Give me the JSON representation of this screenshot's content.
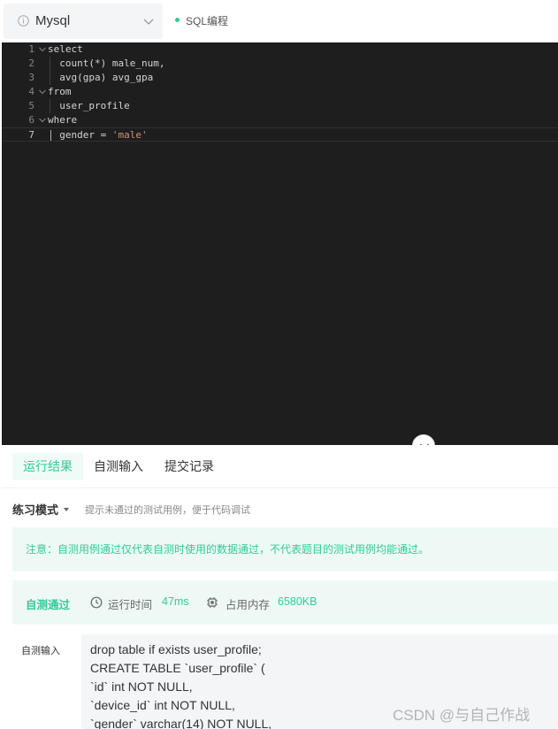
{
  "top": {
    "language": "Mysql",
    "mode_tag": "SQL编程"
  },
  "editor": {
    "lines": [
      {
        "n": "1",
        "code": "select"
      },
      {
        "n": "2",
        "code": "  count(*) male_num,"
      },
      {
        "n": "3",
        "code": "  avg(gpa) avg_gpa"
      },
      {
        "n": "4",
        "code": "from"
      },
      {
        "n": "5",
        "code": "  user_profile"
      },
      {
        "n": "6",
        "code": "where"
      },
      {
        "n": "7",
        "code": "  gender = 'male'"
      }
    ]
  },
  "tabs": {
    "result": "运行结果",
    "custom_input": "自测输入",
    "history": "提交记录"
  },
  "result": {
    "practice_mode": "练习模式",
    "practice_hint": "提示未通过的测试用例，便于代码调试",
    "notice": "注意：自测用例通过仅代表自测时使用的数据通过，不代表题目的测试用例均能通过。",
    "pass_label": "自测通过",
    "run_time_label": "运行时间",
    "run_time_value": "47ms",
    "memory_label": "占用内存",
    "memory_value": "6580KB",
    "input_label": "自测输入",
    "input_sql": "drop table if exists user_profile;\nCREATE TABLE `user_profile` (\n`id` int NOT NULL,\n`device_id` int NOT NULL,\n`gender` varchar(14) NOT NULL,"
  },
  "watermark": "CSDN @与自己作战",
  "colors": {
    "accent": "#32ca99",
    "editor_bg": "#1e1e1e",
    "keyword": "#569cd6",
    "string": "#ce9178"
  }
}
